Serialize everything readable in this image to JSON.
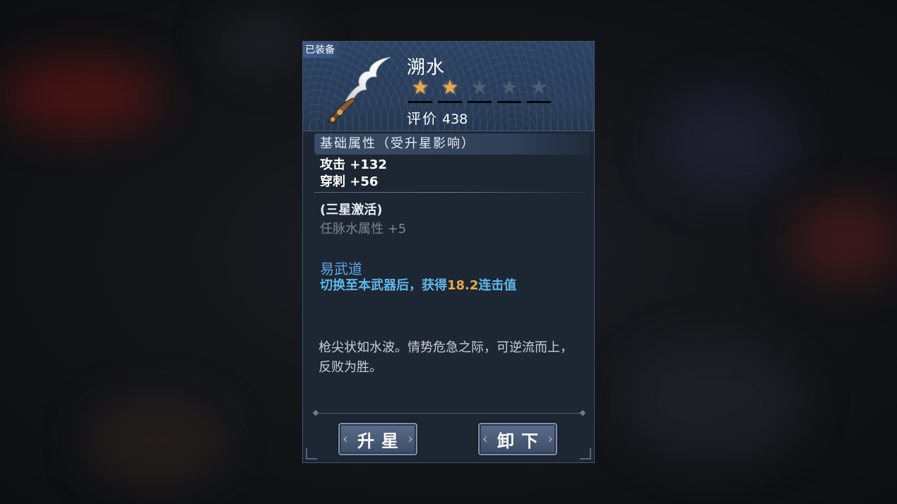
{
  "header": {
    "equipped_tag": "已装备",
    "item_name": "溯水",
    "stars": {
      "filled": 2,
      "total": 5
    },
    "rating_label": "评价",
    "rating_value": "438"
  },
  "base_stats": {
    "title": "基础属性（受升星影响）",
    "attack": "攻击 +132",
    "pierce": "穿刺 +56"
  },
  "star_bonus": {
    "title": "(三星激活)",
    "line": "任脉水属性 +5"
  },
  "skill": {
    "name": "易武道",
    "desc_prefix": "切换至本武器后，获得",
    "desc_value": "18.2",
    "desc_suffix": "连击值"
  },
  "lore": "枪尖状如水波。情势危急之际，可逆流而上，反败为胜。",
  "buttons": {
    "upgrade": "升星",
    "unequip": "卸下"
  },
  "colors": {
    "star_filled": "#e8a94a",
    "skill_name": "#5fa8e6",
    "skill_value": "#e8a94a"
  },
  "icons": [
    "weapon-spear-icon",
    "star-icon",
    "chevron-left-icon",
    "chevron-right-icon"
  ]
}
